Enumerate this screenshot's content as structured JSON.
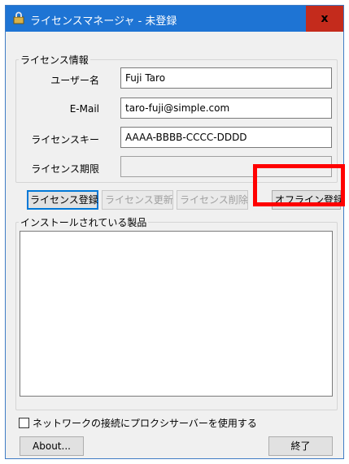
{
  "window": {
    "title": "ライセンスマネージャ - 未登録",
    "close_label": "x"
  },
  "license_info": {
    "group_label": "ライセンス情報",
    "user_name": {
      "label": "ユーザー名",
      "value": "Fuji Taro"
    },
    "email": {
      "label": "E-Mail",
      "value": "taro-fuji@simple.com"
    },
    "license_key": {
      "label": "ライセンスキー",
      "value": "AAAA-BBBB-CCCC-DDDD"
    },
    "license_expiry": {
      "label": "ライセンス期限",
      "value": ""
    }
  },
  "buttons": {
    "register": "ライセンス登録",
    "update": "ライセンス更新",
    "delete": "ライセンス削除",
    "offline_register": "オフライン登録"
  },
  "installed_products": {
    "group_label": "インストールされている製品",
    "items": []
  },
  "proxy": {
    "label": "ネットワークの接続にプロクシサーバーを使用する",
    "checked": false
  },
  "footer": {
    "about": "About...",
    "exit": "終了"
  },
  "colors": {
    "titlebar": "#1e74d4",
    "close": "#c42b1c",
    "highlight": "#ff0000"
  }
}
